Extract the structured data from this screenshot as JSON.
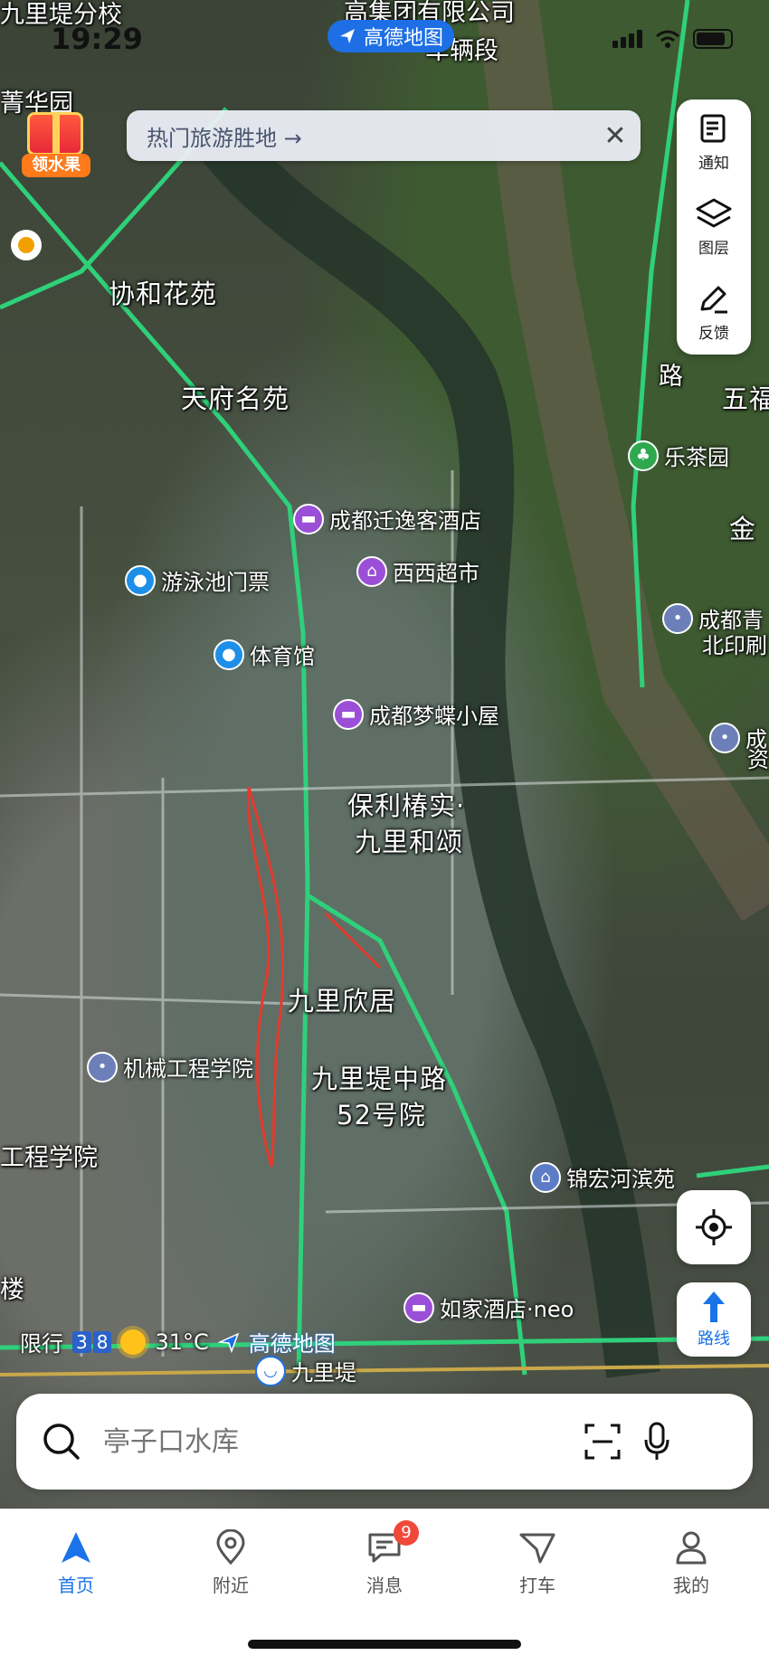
{
  "status_bar": {
    "time": "19:29"
  },
  "app_badge": {
    "label": "高德地图"
  },
  "promo": {
    "label": "领水果"
  },
  "tour_banner": {
    "text": "热门旅游胜地 →"
  },
  "right_toolbar": {
    "items": [
      {
        "label": "通知",
        "icon": "document-icon"
      },
      {
        "label": "图层",
        "icon": "layers-icon"
      },
      {
        "label": "反馈",
        "icon": "edit-icon"
      }
    ]
  },
  "map": {
    "area_labels": [
      "九里堤分校",
      "高集团有限公司",
      "车辆段",
      "菁华园",
      "协和花苑",
      "天府名苑",
      "保利椿实·",
      "九里和颂",
      "九里欣居",
      "九里堤中路",
      "52号院",
      "工程学院",
      "楼",
      "五福",
      "金",
      "路"
    ],
    "pois": [
      {
        "name": "成都迁逸客酒店",
        "type": "hotel"
      },
      {
        "name": "西西超市",
        "type": "shop"
      },
      {
        "name": "游泳池门票",
        "type": "sport"
      },
      {
        "name": "体育馆",
        "type": "sport"
      },
      {
        "name": "成都梦蝶小屋",
        "type": "hotel"
      },
      {
        "name": "乐茶园",
        "type": "park"
      },
      {
        "name": "成都青",
        "type": "place"
      },
      {
        "name": "北印刷",
        "type": "place"
      },
      {
        "name": "成",
        "type": "place"
      },
      {
        "name": "资",
        "type": "place"
      },
      {
        "name": "机械工程学院",
        "type": "place"
      },
      {
        "name": "锦宏河滨苑",
        "type": "res"
      },
      {
        "name": "如家酒店·neo",
        "type": "hotel"
      },
      {
        "name": "九里堤",
        "type": "transit"
      }
    ]
  },
  "weather": {
    "restriction": "限行",
    "plate1": "3",
    "plate2": "8",
    "temperature": "31°C",
    "brand": "高德地图"
  },
  "controls": {
    "route_label": "路线"
  },
  "search": {
    "placeholder": "亭子口水库"
  },
  "tabs": [
    {
      "label": "首页",
      "active": true
    },
    {
      "label": "附近",
      "active": false
    },
    {
      "label": "消息",
      "active": false,
      "badge": "9"
    },
    {
      "label": "打车",
      "active": false
    },
    {
      "label": "我的",
      "active": false
    }
  ]
}
